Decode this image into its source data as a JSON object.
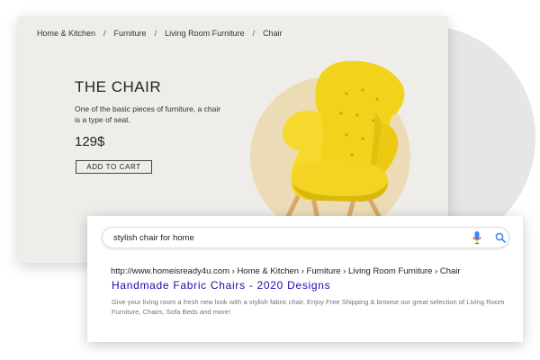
{
  "breadcrumb": {
    "items": [
      "Home & Kitchen",
      "Furniture",
      "Living Room Furniture",
      "Chair"
    ],
    "separator": "/"
  },
  "product": {
    "title": "THE CHAIR",
    "description": "One of the basic pieces of furniture, a chair is a type of seat.",
    "price": "129$",
    "cart_label": "ADD TO CART",
    "chair_color": "#f2d21b",
    "circle_color": "#ecdcb6"
  },
  "search": {
    "query": "stylish chair for home",
    "mic_icon": "mic-icon",
    "search_icon": "magnifier-icon"
  },
  "result": {
    "url": "http://www.homeisready4u.com › Home & Kitchen › Furniture › Living Room Furniture › Chair",
    "title": "Handmade Fabric Chairs - 2020 Designs",
    "snippet": "Give your living room a fresh new look with a stylish fabric chair. Enjoy Free Shipping & browse our great selection of Living Room Furniture, Chairs, Sofa Beds and more!",
    "title_color": "#1a0dab"
  }
}
